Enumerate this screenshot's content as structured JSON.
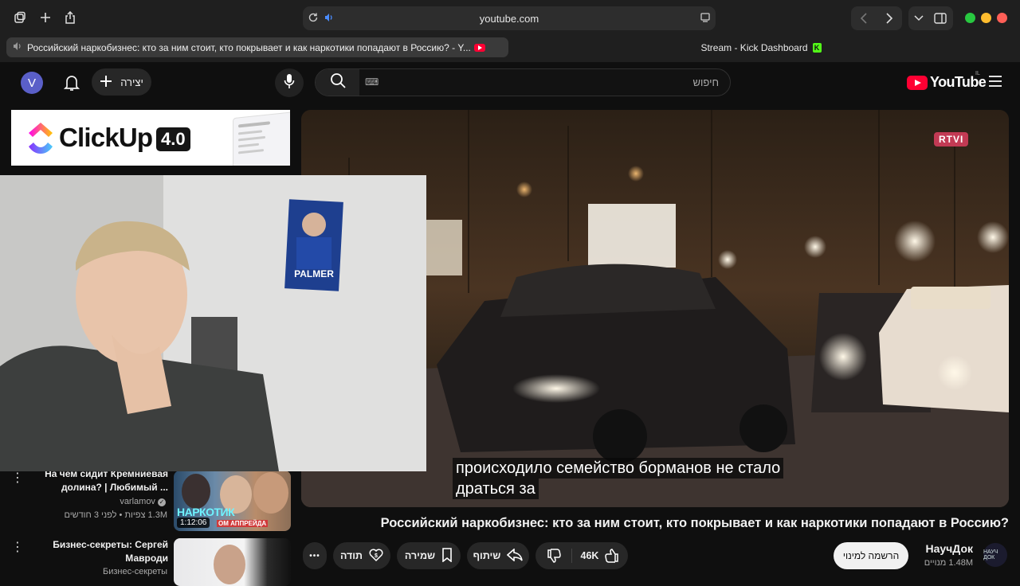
{
  "browser": {
    "url": "youtube.com",
    "tabs": [
      {
        "label": "Российский наркобизнес: кто за ним стоит, кто покрывает и как наркотики попадают в Россию? - Y..."
      },
      {
        "label": "Stream - Kick Dashboard"
      }
    ],
    "colors": {
      "close": "#ff5f57",
      "minimize": "#febc2e",
      "zoom": "#28c840"
    }
  },
  "header": {
    "avatar_letter": "V",
    "create_label": "יצירה",
    "search_placeholder": "חיפוש",
    "logo_text": "YouTube",
    "country_code": "IL"
  },
  "ad": {
    "brand": "ClickUp",
    "version": "4.0"
  },
  "player": {
    "overlay_logo": "RTVI",
    "caption_lines": [
      "происходило семейство борманов не стало",
      "драться за"
    ]
  },
  "video": {
    "title": "Российский наркобизнес: кто за ним стоит, кто покрывает и как наркотики попадают в Россию?",
    "likes": "46K",
    "share_label": "שיתוף",
    "save_label": "שמירה",
    "thanks_label": "תודה",
    "more_label": "•••"
  },
  "channel": {
    "name": "НаучДок",
    "subscribers": "1.48M מנויים",
    "subscribe_label": "הרשמה למינוי",
    "avatar_text": "НАУЧ ДОК"
  },
  "recommendations": [
    {
      "title_line1": "На чем сидит Кремниевая",
      "title_line2": "долина? | Любимый ...",
      "channel": "varlamov",
      "meta": "1.3M צפיות • לפני 3 חודשים",
      "duration": "1:12:06",
      "thumb_text": "НАРКОТИК",
      "thumb_subtext": "ОМ АППРЕЙДА"
    },
    {
      "title_line1": "Бизнес-секреты: Сергей",
      "title_line2": "Мавроди",
      "channel": "Бизнес-секреты",
      "meta": "",
      "duration": ""
    }
  ]
}
